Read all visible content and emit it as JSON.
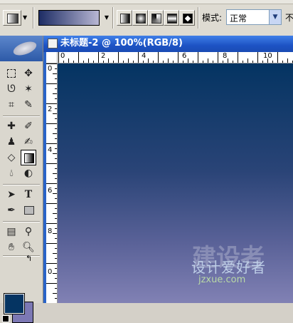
{
  "options_bar": {
    "mode_label": "模式:",
    "mode_value": "正常",
    "opacity_label_partial": "不"
  },
  "document": {
    "title": "未标题-2 @ 100%(RGB/8)",
    "ruler_top_numbers": [
      "0",
      "2",
      "4",
      "6",
      "8",
      "10"
    ],
    "ruler_left_numbers": [
      "0",
      "2",
      "4",
      "6",
      "8",
      "0"
    ]
  },
  "watermark": {
    "main": "设计爱好者",
    "url": "jzxue.com",
    "big": "建设者"
  },
  "colors": {
    "foreground": "#053462",
    "background": "#7c78b4",
    "gradient_start": "#1d2c64",
    "gradient_end": "#b8b7d4"
  },
  "icons": {
    "gradient_tool": "gradient-tool-icon",
    "marquee": "marquee-icon",
    "move": "move-icon",
    "lasso": "lasso-icon",
    "magic_wand": "magic-wand-icon",
    "crop": "crop-icon",
    "slice": "slice-icon",
    "healing": "healing-brush-icon",
    "brush": "brush-icon",
    "stamp": "clone-stamp-icon",
    "history_brush": "history-brush-icon",
    "eraser": "eraser-icon",
    "gradient": "gradient-icon",
    "blur": "blur-icon",
    "dodge": "dodge-icon",
    "path_select": "path-selection-icon",
    "type": "type-icon",
    "pen": "pen-icon",
    "shape": "shape-icon",
    "notes": "notes-icon",
    "eyedropper": "eyedropper-icon",
    "hand": "hand-icon",
    "zoom": "zoom-icon"
  }
}
